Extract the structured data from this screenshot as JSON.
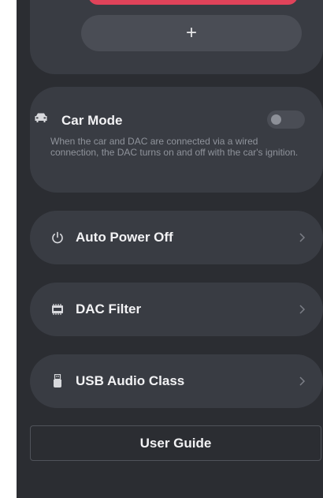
{
  "top_card": {
    "add_label": "+"
  },
  "car_mode": {
    "title": "Car Mode",
    "description": "When the car and DAC are connected via a wired connection, the DAC turns on and off with the car's ignition.",
    "enabled": false
  },
  "rows": [
    {
      "label": "Auto Power Off",
      "icon": "power-icon"
    },
    {
      "label": "DAC Filter",
      "icon": "dac-chip-icon"
    },
    {
      "label": "USB Audio Class",
      "icon": "usb-icon"
    }
  ],
  "footer": {
    "guide_label": "User Guide"
  },
  "colors": {
    "background": "#2b2d32",
    "card": "#393c43",
    "accent_red": "#e0435a",
    "text": "#f2f2f4",
    "muted_text": "#8f939b"
  }
}
